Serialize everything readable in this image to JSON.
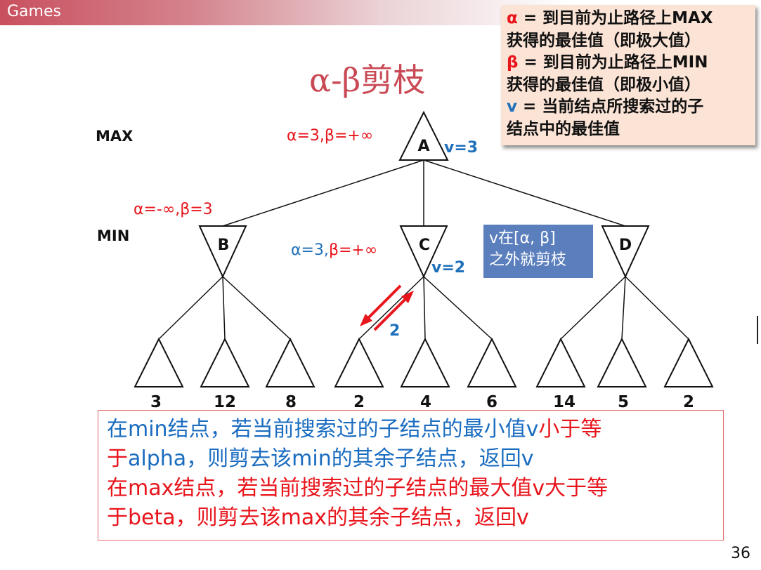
{
  "header": {
    "label": "Games"
  },
  "title": "α-β剪枝",
  "legend": {
    "alpha_symbol": "α",
    "alpha_line1": " = 到目前为止路径上MAX",
    "alpha_line2": "获得的最佳值（即极大值）",
    "beta_symbol": "β",
    "beta_line1": " = 到目前为止路径上MIN",
    "beta_line2": "获得的最佳值（即极小值）",
    "v_symbol": "v",
    "v_line1": " = 当前结点所搜索过的子",
    "v_line2": "结点中的最佳值"
  },
  "levels": {
    "max": "MAX",
    "min": "MIN"
  },
  "nodes": {
    "A": {
      "label": "A",
      "ab": "α=3,β=+∞",
      "v": "v=3"
    },
    "B": {
      "label": "B",
      "ab": "α=-∞,β=3"
    },
    "C": {
      "label": "C",
      "ab_alpha": "α=3,",
      "ab_beta": "β=+∞",
      "v": "v=2"
    },
    "D": {
      "label": "D"
    }
  },
  "leaves": [
    "3",
    "12",
    "8",
    "2",
    "4",
    "6",
    "14",
    "5",
    "2"
  ],
  "arrow_value": "2",
  "note": {
    "line1": "v在[α, β]",
    "line2": "之外就剪枝"
  },
  "rule": {
    "l1_blue": "在min结点，若当前搜索过的子结点的最小值v",
    "l1_red": "小于等",
    "l2_red": "于",
    "l2_blue": "alpha，则剪去该min的其余子结点，返回v",
    "l3_red1": "在max结点，若当前搜索过的子结点的最大值v",
    "l3_red2": "大于等",
    "l4_red": "于beta，则剪去该max的其余子结点，返回v"
  },
  "page_number": "36",
  "colors": {
    "red": "#e8151c",
    "blue": "#1f6fba",
    "title": "#c94a55",
    "legend_bg": "#fbe4d6",
    "note_bg": "#5b7fbd"
  }
}
